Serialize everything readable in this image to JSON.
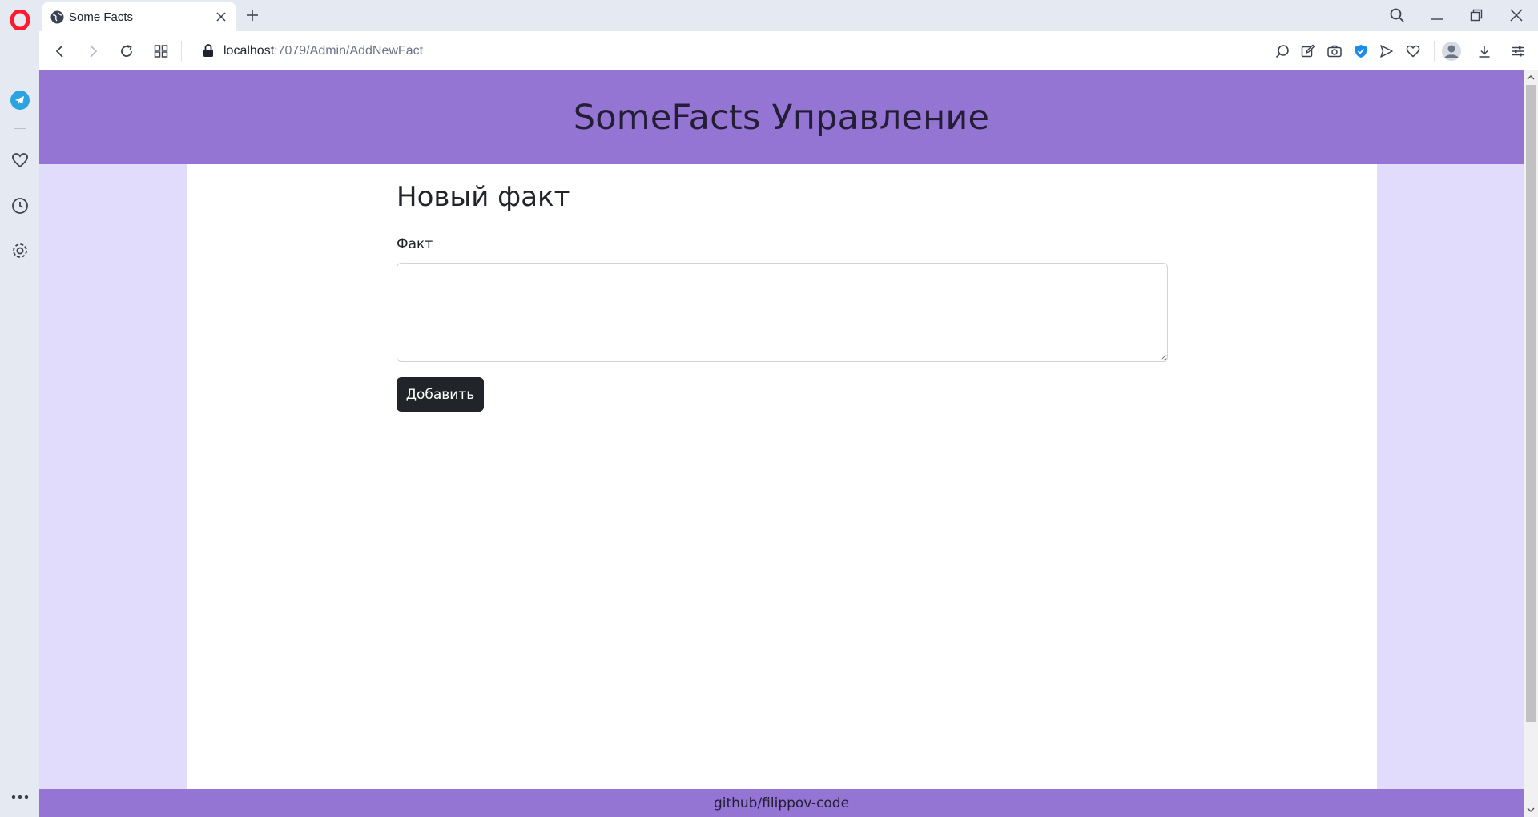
{
  "browser": {
    "tab": {
      "title": "Some Facts"
    },
    "address": {
      "host": "localhost",
      "path": ":7079/Admin/AddNewFact"
    }
  },
  "site": {
    "title": "SomeFacts Управление",
    "heading": "Новый факт",
    "field_label": "Факт",
    "fact_value": "",
    "add_button_label": "Добавить",
    "footer": "github/filippov-code"
  },
  "colors": {
    "header": "#9475d3",
    "page_background": "#e1dcfc",
    "button": "#212529",
    "opera_red": "#ff1b2d"
  },
  "icons": [
    "opera-logo-icon",
    "telegram-icon",
    "heart-icon",
    "history-icon",
    "settings-icon",
    "more-icon",
    "globe-icon",
    "close-icon",
    "plus-icon",
    "search-icon",
    "minimize-icon",
    "restore-icon",
    "back-icon",
    "forward-icon",
    "reload-icon",
    "tabs-grid-icon",
    "lock-icon",
    "lens-icon",
    "edit-icon",
    "camera-icon",
    "vpn-shield-icon",
    "send-icon",
    "heart-icon",
    "profile-icon",
    "download-icon",
    "easy-setup-icon"
  ]
}
